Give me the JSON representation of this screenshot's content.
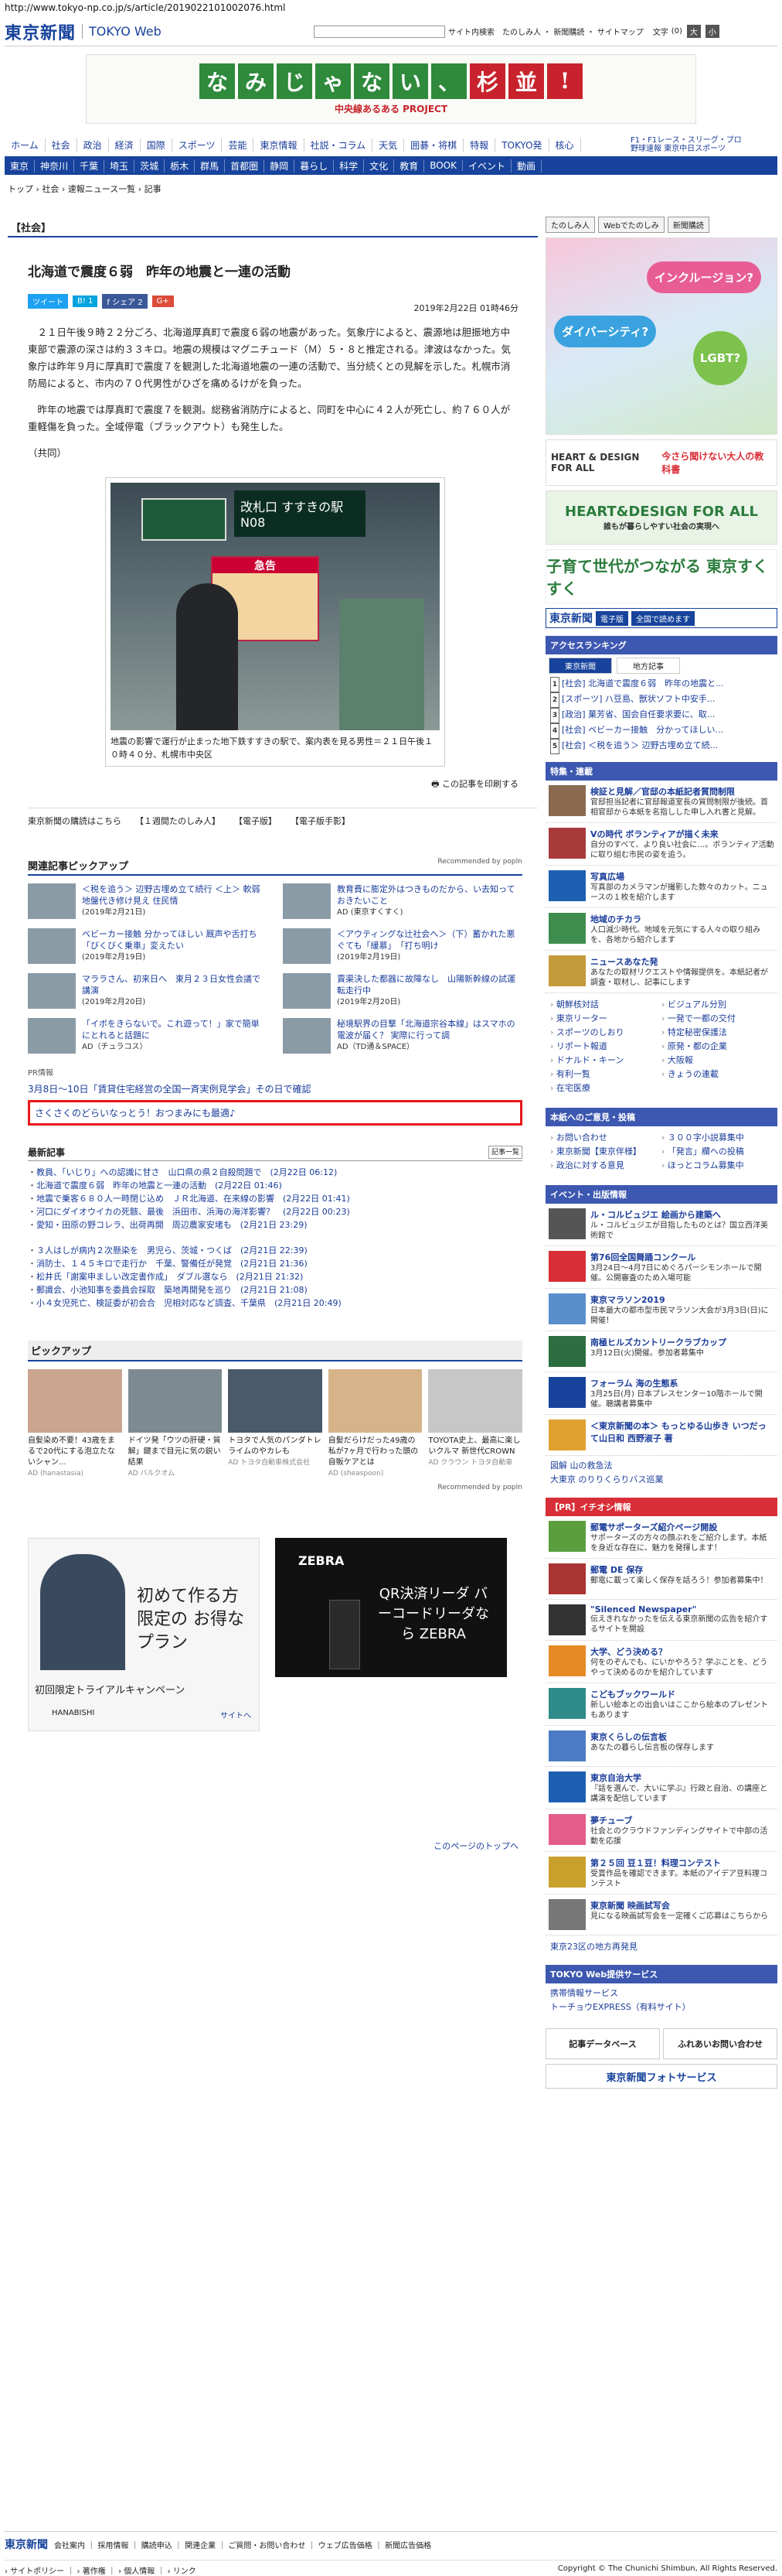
{
  "url": "http://www.tokyo-np.co.jp/s/article/2019022101002076.html",
  "header": {
    "logo": "東京新聞",
    "sublogo": "TOKYO Web",
    "site_search": "サイト内検索",
    "links": "たのしみ人 ・ 新聞購読 ・ サイトマップ",
    "fontsize": "文字",
    "fs0": "(0)",
    "fs_big": "大",
    "fs_small": "小"
  },
  "banner": {
    "chars": [
      "な",
      "み",
      "じ",
      "ゃ",
      "な",
      "い",
      "、",
      "杉",
      "並",
      "!"
    ],
    "sub": "中央線あるある PROJECT"
  },
  "nav1": [
    "ホーム",
    "社会",
    "政治",
    "経済",
    "国際",
    "スポーツ",
    "芸能",
    "東京情報",
    "社説・コラム",
    "天気",
    "囲碁・将棋",
    "特報",
    "TOKYO発",
    "核心"
  ],
  "sports_link": "F1・F1レース・スリーグ・プロ野球速報 東京中日スポーツ",
  "nav2": [
    "東京",
    "神奈川",
    "千葉",
    "埼玉",
    "茨城",
    "栃木",
    "群馬",
    "首都圏",
    "静岡",
    "暮らし",
    "科学",
    "文化",
    "教育",
    "BOOK",
    "イベント",
    "動画"
  ],
  "breadcrumb": "トップ › 社会 › 速報ニュース一覧 › 記事",
  "section": "【社会】",
  "article": {
    "title": "北海道で震度６弱　昨年の地震と一連の活動",
    "tweet": "ツイート",
    "b": "B! 1",
    "share": "f シェア 2",
    "g": "G+",
    "date": "2019年2月22日 01時46分",
    "p1": "２１日午後９時２２分ごろ、北海道厚真町で震度６弱の地震があった。気象庁によると、震源地は胆振地方中東部で震源の深さは約３３キロ。地震の規模はマグニチュード（Ｍ）５・８と推定される。津波はなかった。気象庁は昨年９月に厚真町で震度７を観測した北海道地震の一連の活動で、当分続くとの見解を示した。札幌市消防局によると、市内の７０代男性がひざを痛めるけがを負った。",
    "p2": "昨年の地震では厚真町で震度７を観測。総務省消防庁によると、同町を中心に４２人が死亡し、約７６０人が重軽傷を負った。全域停電（ブラックアウト）も発生した。",
    "credit": "（共同）",
    "photo_sign": "改札口 すすきの駅 N08",
    "photo_board": "急告",
    "caption": "地震の影響で運行が止まった地下鉄すすきの駅で、案内表を見る男性＝２１日午後１０時４０分、札幌市中央区",
    "print": "この記事を印刷する",
    "sublinks": [
      "東京新聞の購読はこちら",
      "【１週間たのしみ人】",
      "【電子版】",
      "【電子版手影】"
    ]
  },
  "pickup_related": {
    "title": "関連記事ピックアップ",
    "rec": "Recommended by popIn",
    "items": [
      {
        "t": "＜税を追う＞ 辺野古埋め立て続行 ＜上＞ 軟弱地盤代き修け見え 住民情",
        "d": "(2019年2月21日)"
      },
      {
        "t": "教育費に膨定外はつきものだから、い去知っておきたいこと",
        "d": "AD (東京すくすく)"
      },
      {
        "t": "ベビーカー接触 分かってほしい 厩声や舌打ち「びくびく乗車」変えたい",
        "d": "(2019年2月19日)"
      },
      {
        "t": "＜アウティングな辻社会へ＞（下）蓄かれた悪ぐても「緩慕」　「打ち明け",
        "d": "(2019年2月19日)"
      },
      {
        "t": "マララさん、初来日へ　東月２３日女性会議で講演",
        "d": "(2019年2月20日)"
      },
      {
        "t": "賣渠決した都器に故障なし　山陽新幹線の試運転走行中",
        "d": "(2019年2月20日)"
      },
      {
        "t": "「イボをきらないで。これ遊って！」家で簡単にとれると話題に",
        "d": "AD（チュラコス）"
      },
      {
        "t": "秘境駅界の目撃「北海道宗谷本線」はスマホの電波が届く？ 実際に行って調",
        "d": "AD（TD通＆SPACE）"
      }
    ]
  },
  "pr_label": "PR情報",
  "pr_link": "3月8日〜10日「賃貸住宅経営の全国一斉実例見学会」その日で確認",
  "highlighted_link": "さくさくのどらいなっとう！おつまみにも最適♪",
  "latest": {
    "title": "最新記事",
    "more": "記事一覧",
    "group1": [
      "教員、「いじり」への認識に甘さ　山口県の県２自殺問題で　(2月22日 06:12)",
      "北海道で震度６弱　昨年の地震と一連の活動　(2月22日 01:46)",
      "地震で乗客６８０人一時閉じ込め　ＪＲ北海道、在来線の影響　(2月22日 01:41)",
      "河口にダイオウイカの死骸、最後　浜田市、浜海の海洋影響？　(2月22日 00:23)",
      "愛知・田原の野コレラ、出荷再開　周辺農家安堵も　(2月21日 23:29)"
    ],
    "group2": [
      "３人はしが病内２次懸染を　男児ら、茨城・つくば　(2月21日 22:39)",
      "消防士、１４５キロで走行か　千葉、警備任が発覚　(2月21日 21:36)",
      "松井氏「謝案申ましい改定書作成」　ダブル選なら　(2月21日 21:32)",
      "郵識会、小池知事を委員会採取　築地再開発を巡り　(2月21日 21:08)",
      "小４女児死亡、検証委が初会合　児相対応など調査、千葉県　(2月21日 20:49)"
    ]
  },
  "pickup": {
    "title": "ピックアップ",
    "cards": [
      {
        "t": "自髪染め不要！43歳をまるで20代にする泡立たないシャン...",
        "s": "AD (hanastasia)"
      },
      {
        "t": "ドイツ発「ウツの肝硬・質解」鍵まで目元に気の鋭い結果",
        "s": "AD バルクオム"
      },
      {
        "t": "トヨタで人気のパンダトレライムのやカレも",
        "s": "AD トヨタ自動車株式会社"
      },
      {
        "t": "自髪だらけだった49歳の私が7ヶ月で行わった頭の自販ケアとは",
        "s": "AD (sheaspoon)"
      },
      {
        "t": "TOYOTA史上、最高に楽しいクルマ 新世代CROWN",
        "s": "AD クラウン トヨタ自動車"
      }
    ],
    "rec": "Recommended by popIn"
  },
  "ads": {
    "ad1_t1": "初めて作る方 限定の お得なプラン",
    "ad1_t2": "初回限定トライアルキャンペーン",
    "ad1_brand": "HANABISHI",
    "ad1_link": "サイトへ",
    "ad2_brand": "ZEBRA",
    "ad2_q": "QR決済リーダ バーコードリーダなら ZEBRA"
  },
  "pagetop": "このページのトップへ",
  "side": {
    "btns": [
      "たのしみ人",
      "Webでたのしみ",
      "新聞購読"
    ],
    "bubbles": [
      "インクルージョン?",
      "ダイバーシティ?",
      "LGBT?"
    ],
    "hdfa": "HEART & DESIGN FOR ALL",
    "hdfa_sub": "今さら聞けない大人の教科書",
    "hdfb": "HEART&DESIGN FOR ALL",
    "hdfb_sub": "誰もが暮らしやすい社会の実現へ",
    "suku": "子育て世代がつながる 東京すくすく",
    "ts": "東京新聞",
    "ts_tag": "電子版",
    "ts_btn": "全国で読めます",
    "rank_hd": "アクセスランキング",
    "rtabs": [
      "東京新聞",
      "地方記事"
    ],
    "rank": [
      "[社会] 北海道で震度６弱　昨年の地震と...",
      "[スポーツ] ハ豆島、獣状ソフト中安手...",
      "[政治] 菓芳省、国会自任要求要に、取...",
      "[社会] ベビーカー接触　分かってほしい...",
      "[社会] ＜税を追う＞ 辺野古埋め立て続..."
    ],
    "tokuhou_hd": "特集・連載",
    "tokuhou": [
      {
        "t": "検証と見解／官邸の本紙記者質問制限",
        "d": "官邸担当記者に官邸報道室長の質問制限が後続。首相官邸から本紙を名指しした申し入れ書と見解。"
      },
      {
        "t": "Vの時代 ボランティアが描く未来",
        "d": "自分のすべて、より良い社会に…。ボランティア活動に取り組む市民の姿を追う。"
      },
      {
        "t": "写真広場",
        "d": "写真部のカメラマンが撮影した数々のカット。ニュースの１枚を紹介します"
      },
      {
        "t": "地域のチカラ",
        "d": "人口減少時代。地域を元気にする人々の取り組みを、各地から紹介します"
      },
      {
        "t": "ニュースあなた発",
        "d": "あなたの取材リクエストや情報提供を。本紙記者が調査・取材し、記事にします"
      }
    ],
    "links": [
      "朝鮮核対話",
      "ビジュアル分別",
      "東京リーター",
      "一発で一都の交付",
      "スポーツのしおり",
      "特定秘密保護法",
      "リポート報道",
      "原発・都の企業",
      "ドナルド・キーン",
      "大阪報",
      "有利一覧",
      "きょうの連載",
      "在宅医療"
    ],
    "event_hd": "本紙へのご意見・投稿",
    "event_links": [
      "お問い合わせ",
      "３００字小説募集中",
      "東京新聞【東京伴様】",
      "「発言」欄への投稿",
      "政治に対する意見",
      "ほっとコラム募集中"
    ],
    "events_hd": "イベント・出版情報",
    "events": [
      {
        "t": "ル・コルビュジエ 絵画から建築へ",
        "d": "ル・コルビュジエが目指したものとは？国立西洋美術館で"
      },
      {
        "t": "第76回全国舞踊コンクール",
        "d": "3月24日〜4月7日にめぐろパーシモンホールで開催。公開審査のため入場可能"
      },
      {
        "t": "東京マラソン2019",
        "d": "日本最大の都市型市民マラソン大会が3月3日(日)に開催！"
      },
      {
        "t": "南極ヒルズカントリークラブカップ",
        "d": "3月12日(火)開催。参加者募集中"
      },
      {
        "t": "フォーラム 海の生態系",
        "d": "3月25日(月) 日本プレスセンター10階ホールで開催。聴講者募集中"
      },
      {
        "t": "＜東京新聞の本＞ もっとゆる山歩き いつだって山日和 西野淑子 著",
        "d": ""
      }
    ],
    "more_links": [
      "図解 山の救急法",
      "大東京 のりりくらりバス巡業"
    ],
    "ire_hd": "【PR】イチオシ情報",
    "ire": [
      {
        "t": "郵電サポーターズ紹介ページ開設",
        "d": "サポーターズの方々の顔ぶれをご紹介します。本紙を身近な存在に、魅力を発揮します！"
      },
      {
        "t": "郵電 DE 保存",
        "d": "郵電に載って楽しく保存を話ろう！参加者募集中！"
      },
      {
        "t": "\"Silenced Newspaper\"",
        "d": "伝えきれなかったを伝える東京新聞の広告を紹介するサイトを開設"
      },
      {
        "t": "大学、どう決める？",
        "d": "何をのぞんでも、にいかやろう？学ぶことを、どうやって決めるのかを紹介しています"
      },
      {
        "t": "こどもブックワールド",
        "d": "新しい絵本との出会いはここから絵本のプレゼントもあります"
      },
      {
        "t": "東京くらしの伝言板",
        "d": "あなたの暮らし伝言板の保存します"
      },
      {
        "t": "東京自治大学",
        "d": "『話を選んで、大いに学ぶ』行政と自治、の講座と講演を配信しています"
      },
      {
        "t": "夢チューブ",
        "d": "社会とのクラウドファンディングサイトで中部の活動を応援"
      },
      {
        "t": "第２５回 豆１豆！料理コンテスト",
        "d": "受賞作品を確認できます。本紙のアイデア豆料理コンテスト"
      },
      {
        "t": "東京新聞 映画試写会",
        "d": "見になる映画試写会を一定確くご応募はこちらから"
      }
    ],
    "ire_more": "東京23区の地方再発見",
    "tw_hd": "TOKYO Web提供サービス",
    "tw_links": [
      "携帯情報サービス",
      "トーチョウEXPRESS（有料サイト）"
    ],
    "foot_btns": [
      "記事データベース",
      "ふれあいお問い合わせ"
    ],
    "photo_service": "東京新聞フォトサービス"
  },
  "footer": {
    "logo": "東京新聞",
    "links": "会社案内 ｜ 採用情報 ｜ 購読申込 ｜ 関連企業 ｜ ご質問・お問い合わせ ｜ ウェブ広告価格 ｜ 新聞広告価格",
    "bottom_left": "› サイトポリシー ｜ › 著作権 ｜ › 個人情報 ｜ › リンク",
    "copyright": "Copyright © The Chunichi Shimbun, All Rights Reserved."
  }
}
